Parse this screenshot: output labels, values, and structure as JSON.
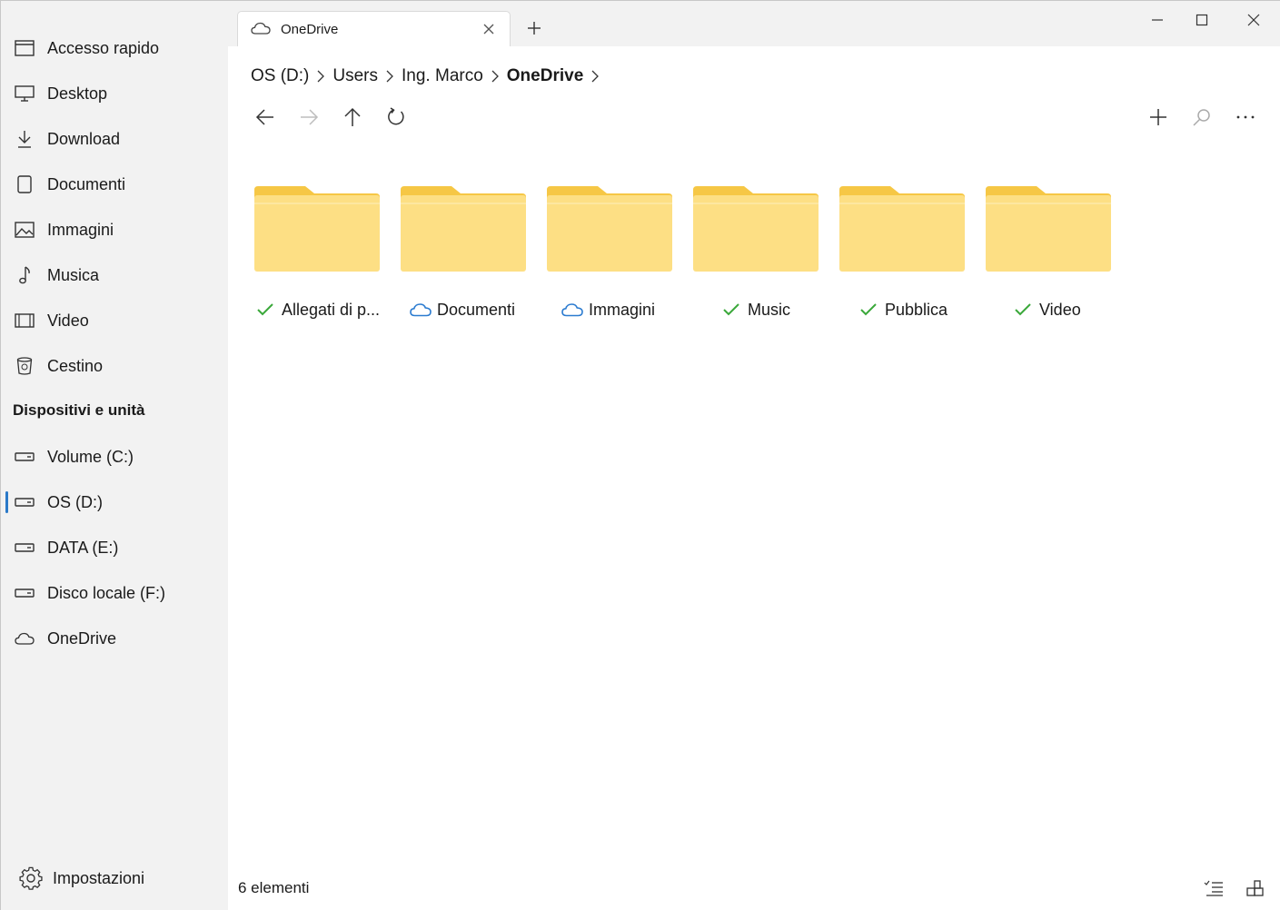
{
  "sidebar": {
    "items": [
      {
        "label": "Accesso rapido",
        "icon": "quick-access-icon"
      },
      {
        "label": "Desktop",
        "icon": "desktop-icon"
      },
      {
        "label": "Download",
        "icon": "download-icon"
      },
      {
        "label": "Documenti",
        "icon": "document-icon"
      },
      {
        "label": "Immagini",
        "icon": "pictures-icon"
      },
      {
        "label": "Musica",
        "icon": "music-icon"
      },
      {
        "label": "Video",
        "icon": "video-icon"
      },
      {
        "label": "Cestino",
        "icon": "recycle-bin-icon"
      }
    ],
    "devices_header": "Dispositivi e unità",
    "devices": [
      {
        "label": "Volume (C:)",
        "icon": "drive-icon"
      },
      {
        "label": "OS (D:)",
        "icon": "drive-icon",
        "selected": true
      },
      {
        "label": "DATA (E:)",
        "icon": "drive-icon"
      },
      {
        "label": "Disco locale (F:)",
        "icon": "drive-icon"
      },
      {
        "label": "OneDrive",
        "icon": "cloud-icon"
      }
    ],
    "settings_label": "Impostazioni"
  },
  "tab": {
    "title": "OneDrive"
  },
  "breadcrumb": [
    "OS (D:)",
    "Users",
    "Ing. Marco",
    "OneDrive"
  ],
  "folders": [
    {
      "name": "Allegati di p...",
      "status": "synced"
    },
    {
      "name": "Documenti",
      "status": "cloud"
    },
    {
      "name": "Immagini",
      "status": "cloud"
    },
    {
      "name": "Music",
      "status": "synced"
    },
    {
      "name": "Pubblica",
      "status": "synced"
    },
    {
      "name": "Video",
      "status": "synced"
    }
  ],
  "status_bar": "6 elementi",
  "colors": {
    "accent": "#2a79c8",
    "synced": "#3aa83a",
    "cloud": "#2b7bd0",
    "folder_back": "#f6c745",
    "folder_front": "#fddf84"
  }
}
